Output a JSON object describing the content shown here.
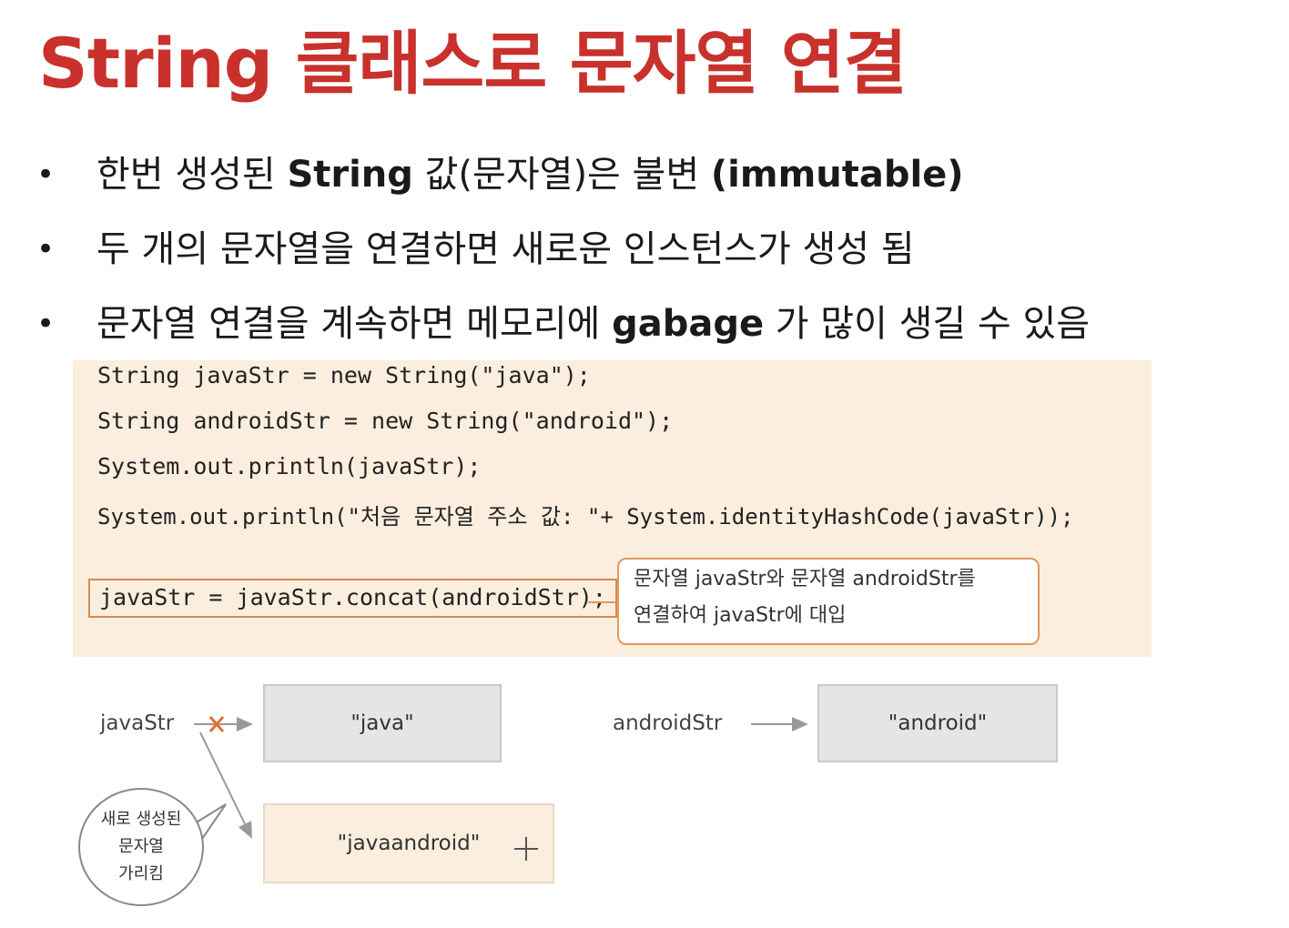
{
  "title": "String 클래스로 문자열 연결",
  "bullets": [
    {
      "marker": "•",
      "pre": "한번 생성된 ",
      "bold": "String",
      "post": " 값(문자열)은 불변 ",
      "bold2": "(immutable)"
    },
    {
      "marker": "•",
      "text": "두 개의 문자열을 연결하면 새로운 인스턴스가 생성 됨"
    },
    {
      "marker": "•",
      "pre": "문자열 연결을 계속하면 메모리에 ",
      "bold": "gabage",
      "post": " 가 많이 생길 수 있음"
    }
  ],
  "code": {
    "lines": [
      "String javaStr = new String(\"java\");",
      "String androidStr = new String(\"android\");",
      "System.out.println(javaStr);",
      "System.out.println(\"처음 문자열 주소 값: \"+ System.identityHashCode(javaStr));"
    ],
    "concat_line": "javaStr = javaStr.concat(androidStr);",
    "callout": [
      "문자열 javaStr와 문자열 androidStr를",
      "연결하여 javaStr에 대입"
    ]
  },
  "diagram": {
    "var1": "javaStr",
    "obj1": "\"java\"",
    "var2": "androidStr",
    "obj2": "\"android\"",
    "obj3": "\"javaandroid\"",
    "bubble": [
      "새로 생성된",
      "문자열",
      "가리킴"
    ],
    "colors": {
      "old_ref_x": "#e0732a",
      "arrow": "#999999"
    }
  }
}
